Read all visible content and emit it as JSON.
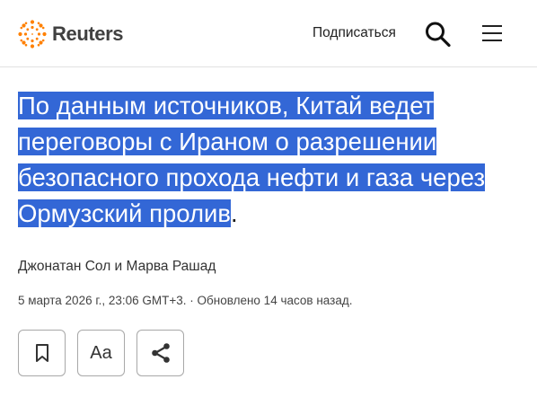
{
  "header": {
    "logo_text": "Reuters",
    "subscribe_label": "Подписаться",
    "search_icon": "search-icon",
    "menu_icon": "hamburger-menu-icon"
  },
  "article": {
    "headline_highlighted": "По данным источников, Китай ведет переговоры с Ираном о разрешении безопасного прохода нефти и газа через Ормузский пролив",
    "headline_tail": ".",
    "authors": "Джонатан Сол и Марва Рашад",
    "dateline": "5 марта 2026 г., 23:06 GMT+3. · Обновлено 14 часов назад."
  },
  "actions": {
    "bookmark_icon": "bookmark-icon",
    "font_label": "Aa",
    "share_icon": "share-icon"
  },
  "colors": {
    "brand": "#ff8000",
    "selection": "#3367d6"
  }
}
